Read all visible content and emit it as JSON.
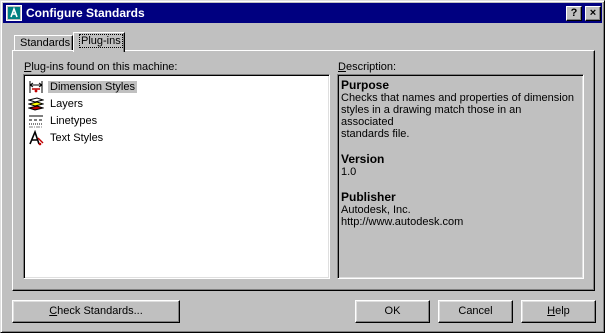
{
  "window": {
    "title": "Configure Standards",
    "help_glyph": "?",
    "close_glyph": "×"
  },
  "tabs": [
    {
      "label": "Standards",
      "selected": false
    },
    {
      "label": "Plug-ins",
      "selected": true
    }
  ],
  "plugins": {
    "label_prefix": "P",
    "label_rest": "lug-ins found on this machine:",
    "items": [
      {
        "label": "Dimension Styles",
        "icon": "dimension-styles-icon",
        "selected": true
      },
      {
        "label": "Layers",
        "icon": "layers-icon",
        "selected": false
      },
      {
        "label": "Linetypes",
        "icon": "linetypes-icon",
        "selected": false
      },
      {
        "label": "Text Styles",
        "icon": "text-styles-icon",
        "selected": false
      }
    ]
  },
  "description": {
    "label_prefix": "D",
    "label_rest": "escription:",
    "purpose_heading": "Purpose",
    "purpose_text": "Checks that names and properties of dimension\nstyles in a drawing match those in an associated\nstandards file.",
    "version_heading": "Version",
    "version_text": "1.0",
    "publisher_heading": "Publisher",
    "publisher_text": "Autodesk, Inc.\nhttp://www.autodesk.com"
  },
  "buttons": {
    "check_prefix": "C",
    "check_rest": "heck Standards...",
    "ok": "OK",
    "cancel": "Cancel",
    "help_prefix": "H",
    "help_rest": "elp"
  },
  "colors": {
    "titlebar": "#000080",
    "face": "#c0c0c0",
    "list_background": "#ffffff"
  }
}
